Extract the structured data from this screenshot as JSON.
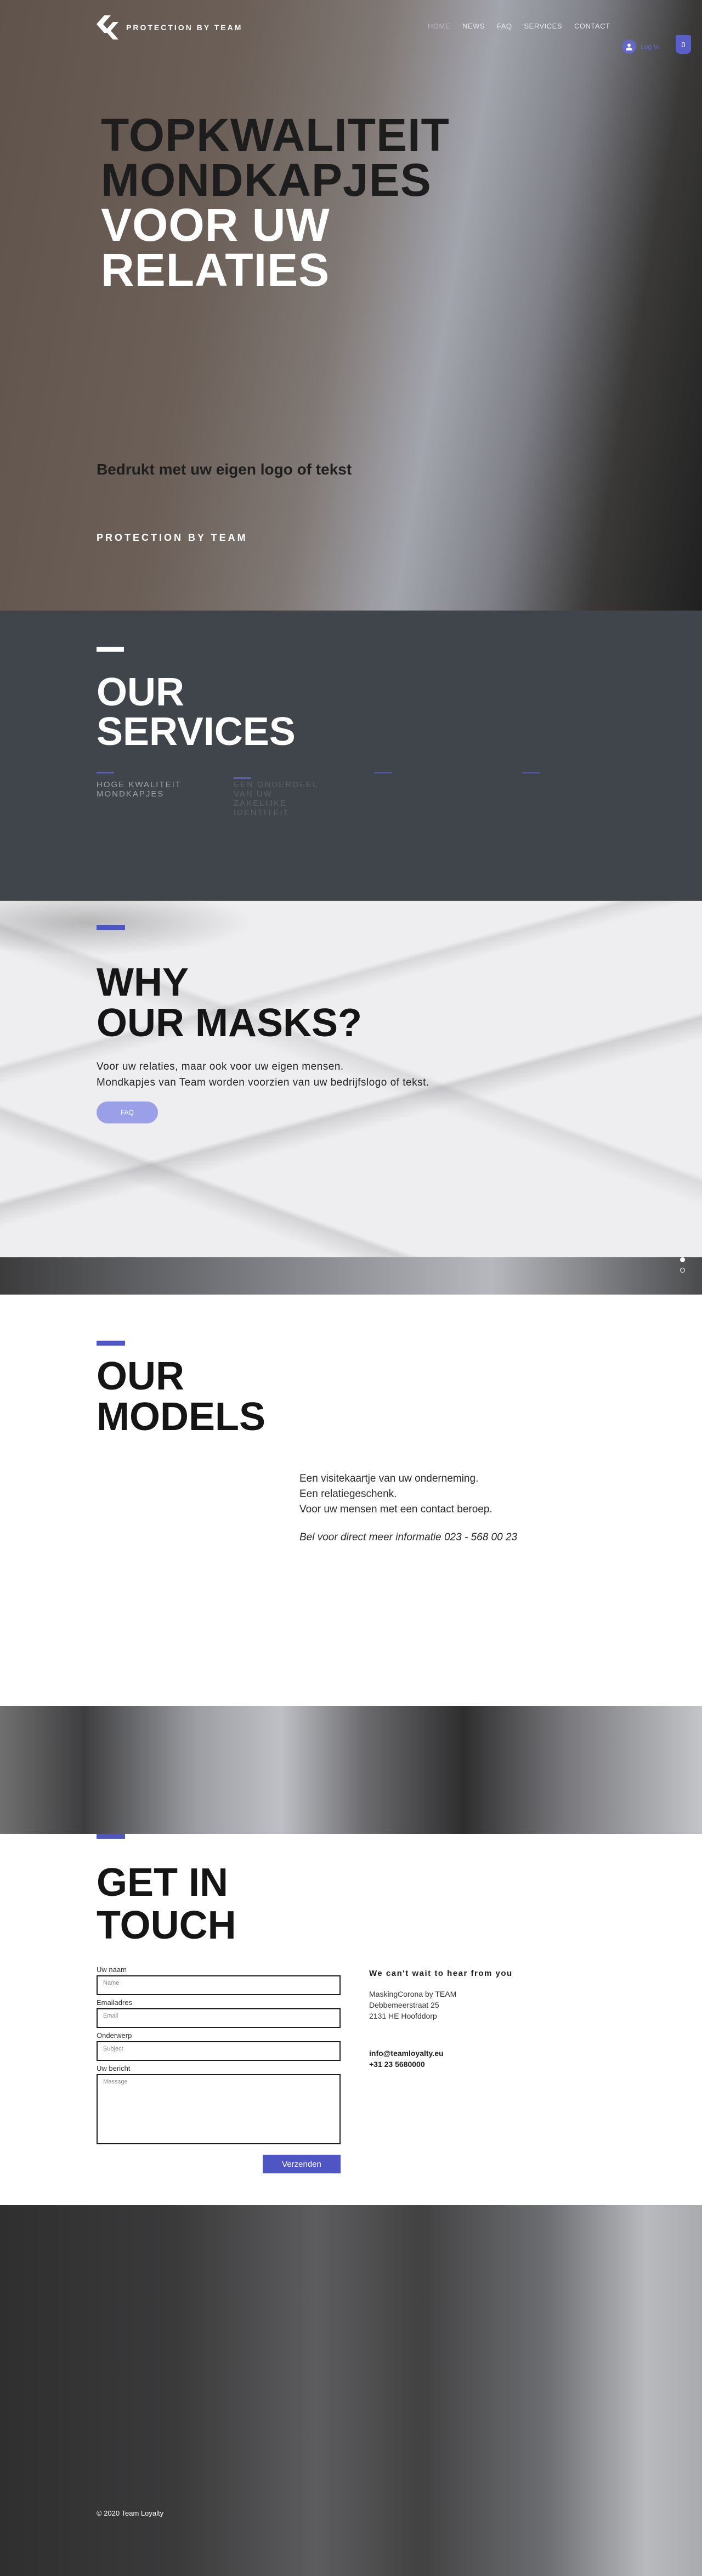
{
  "header": {
    "brand": "PROTECTION BY TEAM",
    "nav": [
      {
        "label": "HOME",
        "active": true
      },
      {
        "label": "NEWS",
        "active": false
      },
      {
        "label": "FAQ",
        "active": false
      },
      {
        "label": "SERVICES",
        "active": false
      },
      {
        "label": "CONTACT",
        "active": false
      }
    ],
    "login_label": "Log In",
    "cart_count": "0"
  },
  "hero": {
    "title_line1": "TOPKWALITEIT",
    "title_line2": "MONDKAPJES",
    "title_line3": "VOOR UW",
    "title_line4": "RELATIES",
    "subtitle": "Bedrukt met uw eigen logo of tekst",
    "brand": "PROTECTION BY TEAM"
  },
  "services": {
    "title_line1": "OUR",
    "title_line2": "SERVICES",
    "items": [
      {
        "text": "HOGE KWALITEIT MONDKAPJES",
        "color": "#9ea2ae"
      },
      {
        "text": "EEN ONDERDEEL VAN UW ZAKELIJKE IDENTITEIT",
        "color": "#5c606b"
      },
      {
        "text": "",
        "color": "#4a4e58"
      },
      {
        "text": "",
        "color": "#4a4e58"
      }
    ]
  },
  "why": {
    "title_line1": "WHY",
    "title_line2": "OUR MASKS?",
    "text_line1": "Voor uw relaties, maar ook voor uw eigen mensen.",
    "text_line2": "Mondkapjes van Team worden voorzien van uw bedrijfslogo of tekst.",
    "button_label": "FAQ"
  },
  "models": {
    "title_line1": "OUR",
    "title_line2": "MODELS",
    "text_line1": "Een visitekaartje van uw onderneming.",
    "text_line2": "Een relatiegeschenk.",
    "text_line3": "Voor uw mensen met een contact beroep.",
    "call": "Bel voor direct meer informatie 023 - 568 00 23"
  },
  "contact": {
    "title_line1": "GET IN",
    "title_line2": "TOUCH",
    "form": {
      "name_label": "Uw naam",
      "name_placeholder": "Name",
      "email_label": "Emailadres",
      "email_placeholder": "Email",
      "subject_label": "Onderwerp",
      "subject_placeholder": "Subject",
      "message_label": "Uw bericht",
      "message_placeholder": "Message",
      "submit_label": "Verzenden"
    },
    "info": {
      "heading": "We can't wait to hear from you",
      "company": "MaskingCorona by TEAM",
      "street": "Debbemeerstraat 25",
      "city": "2131 HE  Hoofddorp",
      "email": "info@teamloyalty.eu",
      "phone": "+31 23 5680000"
    }
  },
  "footer": {
    "copyright": "© 2020 Team Loyalty"
  },
  "colors": {
    "accent": "#4f55c2",
    "services_bg": "#40444b"
  }
}
